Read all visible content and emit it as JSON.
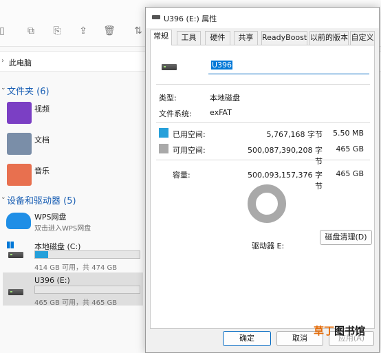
{
  "explorer": {
    "breadcrumb": "此电脑",
    "folders_header": "文件夹 (6)",
    "folders": [
      {
        "label": "视频",
        "color": "#7b3fc4"
      },
      {
        "label": "文档",
        "color": "#7a8ea8"
      },
      {
        "label": "音乐",
        "color": "#e8704f"
      }
    ],
    "devices_header": "设备和驱动器 (5)",
    "wps": {
      "name": "WPS网盘",
      "sub": "双击进入WPS网盘"
    },
    "drives": [
      {
        "name": "本地磁盘 (C:)",
        "free_text": "414 GB 可用，共 474 GB",
        "used_fraction": 0.127
      },
      {
        "name": "U396 (E:)",
        "free_text": "465 GB 可用，共 465 GB",
        "used_fraction": 0.0
      }
    ]
  },
  "dialog": {
    "title": "U396 (E:) 属性",
    "tabs": [
      "常规",
      "工具",
      "硬件",
      "共享",
      "ReadyBoost",
      "以前的版本",
      "自定义"
    ],
    "active_tab": "常规",
    "volume_name": "U396",
    "type_label": "类型:",
    "type_value": "本地磁盘",
    "fs_label": "文件系统:",
    "fs_value": "exFAT",
    "used_label": "已用空间:",
    "used_bytes": "5,767,168 字节",
    "used_size": "5.50 MB",
    "used_color": "#26a0da",
    "free_label": "可用空间:",
    "free_bytes": "500,087,390,208 字节",
    "free_size": "465 GB",
    "free_color": "#a9a9a9",
    "capacity_label": "容量:",
    "capacity_bytes": "500,093,157,376 字节",
    "capacity_size": "465 GB",
    "drive_label": "驱动器 E:",
    "cleanup_button": "磁盘清理(D)",
    "ok_button": "确定",
    "cancel_button": "取消",
    "apply_button": "应用(A)"
  },
  "watermark": {
    "part1": "草丁",
    "part2": "图书馆"
  }
}
